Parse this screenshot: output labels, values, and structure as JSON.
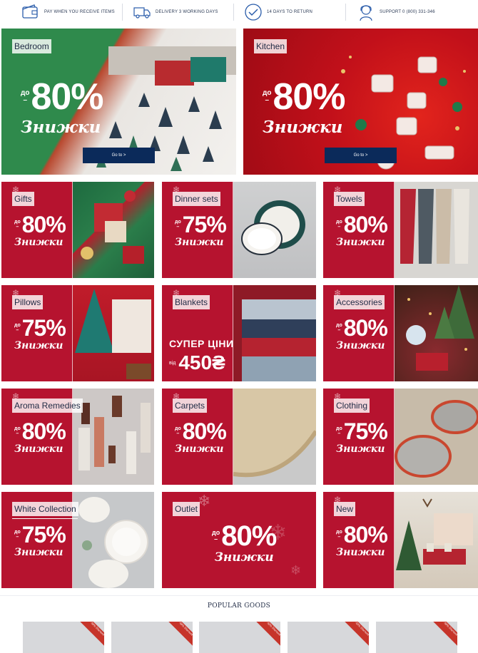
{
  "info_bar": [
    {
      "icon": "wallet-icon",
      "text": "PAY WHEN YOU RECEIVE ITEMS"
    },
    {
      "icon": "truck-icon",
      "text": "DELIVERY 3 WORKING DAYS"
    },
    {
      "icon": "checkmark-icon",
      "text": "14 DAYS TO RETURN"
    },
    {
      "icon": "support-agent-icon",
      "text": "SUPPORT 0 (800) 331-346"
    }
  ],
  "promo_common": {
    "prefix_do": "до",
    "subtitle": "Знижки",
    "goto_label": "Go to >"
  },
  "big_tiles": [
    {
      "label": "Bedroom",
      "discount": "80%",
      "bg": "#2e8a4a"
    },
    {
      "label": "Kitchen",
      "discount": "80%",
      "bg": "#c8101e"
    }
  ],
  "small_tiles": [
    {
      "label": "Gifts",
      "discount": "80%"
    },
    {
      "label": "Dinner sets",
      "discount": "75%"
    },
    {
      "label": "Towels",
      "discount": "80%"
    },
    {
      "label": "Pillows",
      "discount": "75%"
    },
    {
      "label": "Blankets",
      "price_line1": "СУПЕР ЦІНИ",
      "price_from": "від",
      "price_value": "450₴"
    },
    {
      "label": "Accessories",
      "discount": "80%"
    },
    {
      "label": "Aroma Remedies",
      "discount": "80%"
    },
    {
      "label": "Carpets",
      "discount": "80%"
    },
    {
      "label": "Clothing",
      "discount": "75%"
    },
    {
      "label": "White Collection",
      "discount": "75%"
    },
    {
      "label": "Outlet",
      "discount": "80%"
    },
    {
      "label": "New",
      "discount": "80%"
    }
  ],
  "popular": {
    "title": "POPULAR GOODS",
    "badges": [
      "-56% Discount",
      "-56% Discount",
      "-53% Discount",
      "-53% Discount",
      "-56% Discount"
    ]
  },
  "colors": {
    "promo_red": "#b6132f",
    "navy": "#0b2a5a",
    "ribbon": "#c6342a"
  }
}
